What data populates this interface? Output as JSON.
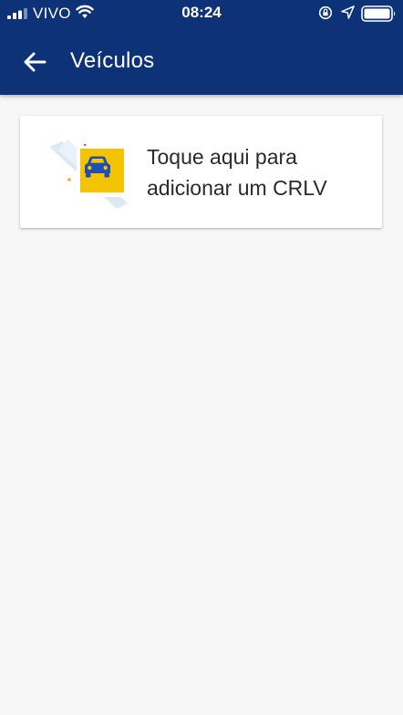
{
  "status_bar": {
    "carrier": "VIVO",
    "time": "08:24",
    "icons": [
      "signal-bars-icon",
      "wifi-icon",
      "rotation-lock-icon",
      "location-arrow-icon",
      "battery-icon"
    ]
  },
  "header": {
    "title": "Veículos",
    "back_icon": "arrow-left-icon",
    "background_color": "#0d3278"
  },
  "add_card": {
    "line1": "Toque aqui para",
    "line2": "adicionar um CRLV",
    "illustration_icon": "car-document-icon",
    "accent_color": "#f5c400"
  }
}
